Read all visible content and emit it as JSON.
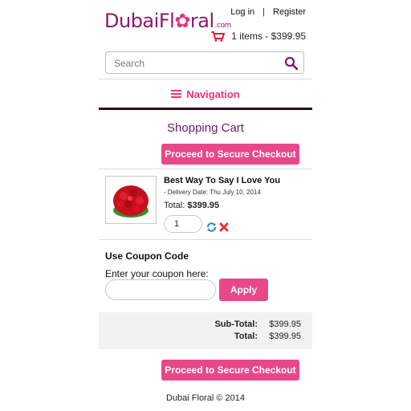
{
  "header": {
    "logo": {
      "part1": "Dubai",
      "part2": "Fl",
      "flower_char": "✿",
      "part3": "ral",
      "suffix": ".com"
    },
    "login_label": "Log in",
    "separator": "|",
    "register_label": "Register",
    "cart_summary": "1 items - $399.95"
  },
  "search": {
    "placeholder": "Search"
  },
  "navigation": {
    "label": "Navigation"
  },
  "page_title": "Shopping Cart",
  "checkout_button_label": "Proceed to Secure Checkout",
  "cart_item": {
    "name": "Best Way To Say I Love You",
    "delivery": "- Delivery Date: Thu July 10, 2014",
    "total_label": "Total:",
    "total_value": "$399.95",
    "quantity": "1"
  },
  "coupon": {
    "title": "Use Coupon Code",
    "label": "Enter your coupon here:",
    "value": "",
    "apply_label": "Apply"
  },
  "totals": {
    "subtotal_label": "Sub-Total:",
    "subtotal_value": "$399.95",
    "total_label": "Total:",
    "total_value": "$399.95"
  },
  "footer": {
    "text": "Dubai Floral © 2014"
  },
  "colors": {
    "accent": "#e8488a",
    "brand": "#8b1a6f",
    "title": "#6b1a6b"
  },
  "icons": [
    "cart-icon",
    "search-icon",
    "menu-icon",
    "refresh-icon",
    "delete-icon"
  ]
}
